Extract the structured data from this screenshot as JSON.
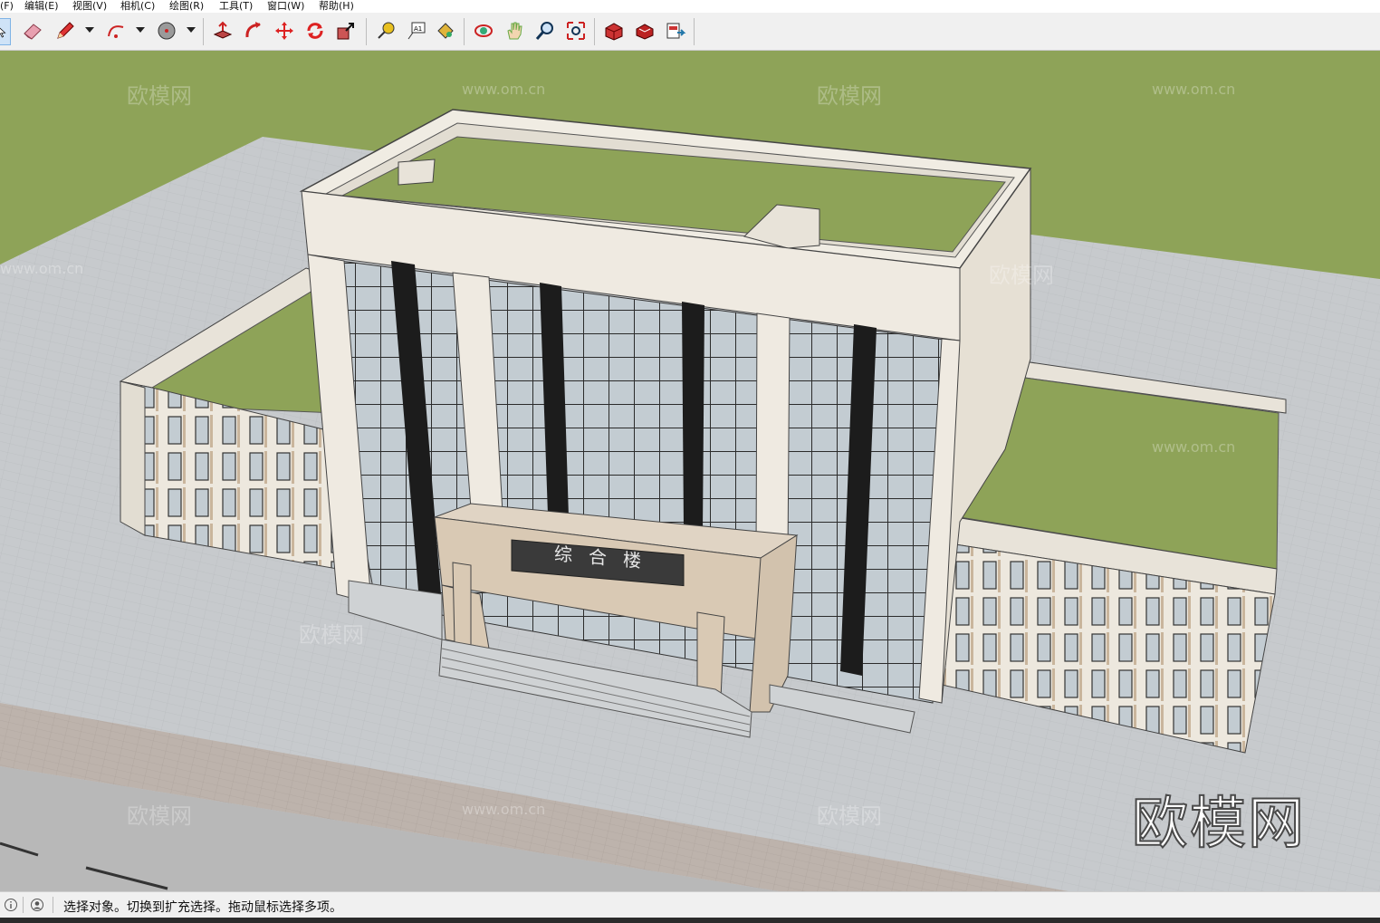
{
  "menu": [
    "(F)",
    "编辑(E)",
    "视图(V)",
    "相机(C)",
    "绘图(R)",
    "工具(T)",
    "窗口(W)",
    "帮助(H)"
  ],
  "toolbar": {
    "icons": [
      "select-arrow-icon",
      "eraser-icon",
      "pencil-icon",
      "arc-icon",
      "circle-icon",
      "push-pull-icon",
      "follow-me-icon",
      "move-icon",
      "rotate-icon",
      "scale-icon",
      "tape-measure-icon",
      "text-icon",
      "paint-bucket-icon",
      "orbit-icon",
      "pan-icon",
      "zoom-icon",
      "zoom-extents-icon",
      "warehouse-icon",
      "extension-icon",
      "send-layout-icon"
    ]
  },
  "viewport": {
    "sign_text": "综合楼",
    "watermarks": [
      "欧模网",
      "www.om.cn"
    ],
    "brand_watermark": "欧模网",
    "colors": {
      "grass": "#8ea358",
      "pavement": "#c6c9cc",
      "facade": "#ede8de",
      "glass": "#c7d0d6",
      "frame": "#1c1c1c"
    }
  },
  "status": {
    "message": "选择对象。切换到扩充选择。拖动鼠标选择多项。"
  }
}
